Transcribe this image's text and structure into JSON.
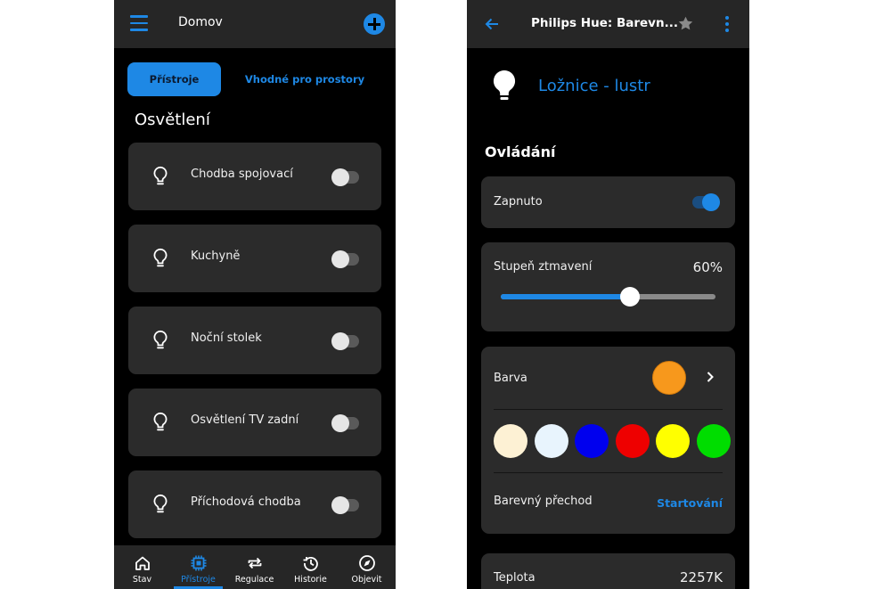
{
  "left": {
    "header": {
      "title": "Domov"
    },
    "tabs": [
      {
        "label": "Přístroje",
        "active": true
      },
      {
        "label": "Vhodné pro prostory",
        "active": false
      }
    ],
    "section_title": "Osvětlení",
    "devices": [
      {
        "name": "Chodba spojovací",
        "on": false
      },
      {
        "name": "Kuchyně",
        "on": false
      },
      {
        "name": "Noční stolek",
        "on": false
      },
      {
        "name": "Osvětlení TV zadní",
        "on": false
      },
      {
        "name": "Příchodová chodba",
        "on": false
      }
    ],
    "nav": [
      {
        "label": "Stav",
        "icon": "home-icon"
      },
      {
        "label": "Přístroje",
        "icon": "chip-icon",
        "active": true
      },
      {
        "label": "Regulace",
        "icon": "repeat-icon"
      },
      {
        "label": "Historie",
        "icon": "history-icon"
      },
      {
        "label": "Objevit",
        "icon": "compass-icon"
      }
    ]
  },
  "right": {
    "header": {
      "title": "Philips Hue: Barevn..."
    },
    "device_title": "Ložnice - lustr",
    "section_title": "Ovládání",
    "power": {
      "label": "Zapnuto",
      "on": true
    },
    "dimmer": {
      "label": "Stupeň ztmavení",
      "value_text": "60%",
      "value": 0.6
    },
    "color": {
      "label": "Barva",
      "current": "#f7981c",
      "swatches": [
        "#fdf1d4",
        "#e8f4fd",
        "#0000ee",
        "#ee0000",
        "#ffff00",
        "#00dd00"
      ],
      "transition_label": "Barevný přechod",
      "transition_action": "Startování"
    },
    "temperature": {
      "label": "Teplota",
      "value_text": "2257K"
    }
  },
  "colors": {
    "accent": "#1e88e5",
    "card": "#2b2b2b",
    "appbar": "#262626"
  }
}
